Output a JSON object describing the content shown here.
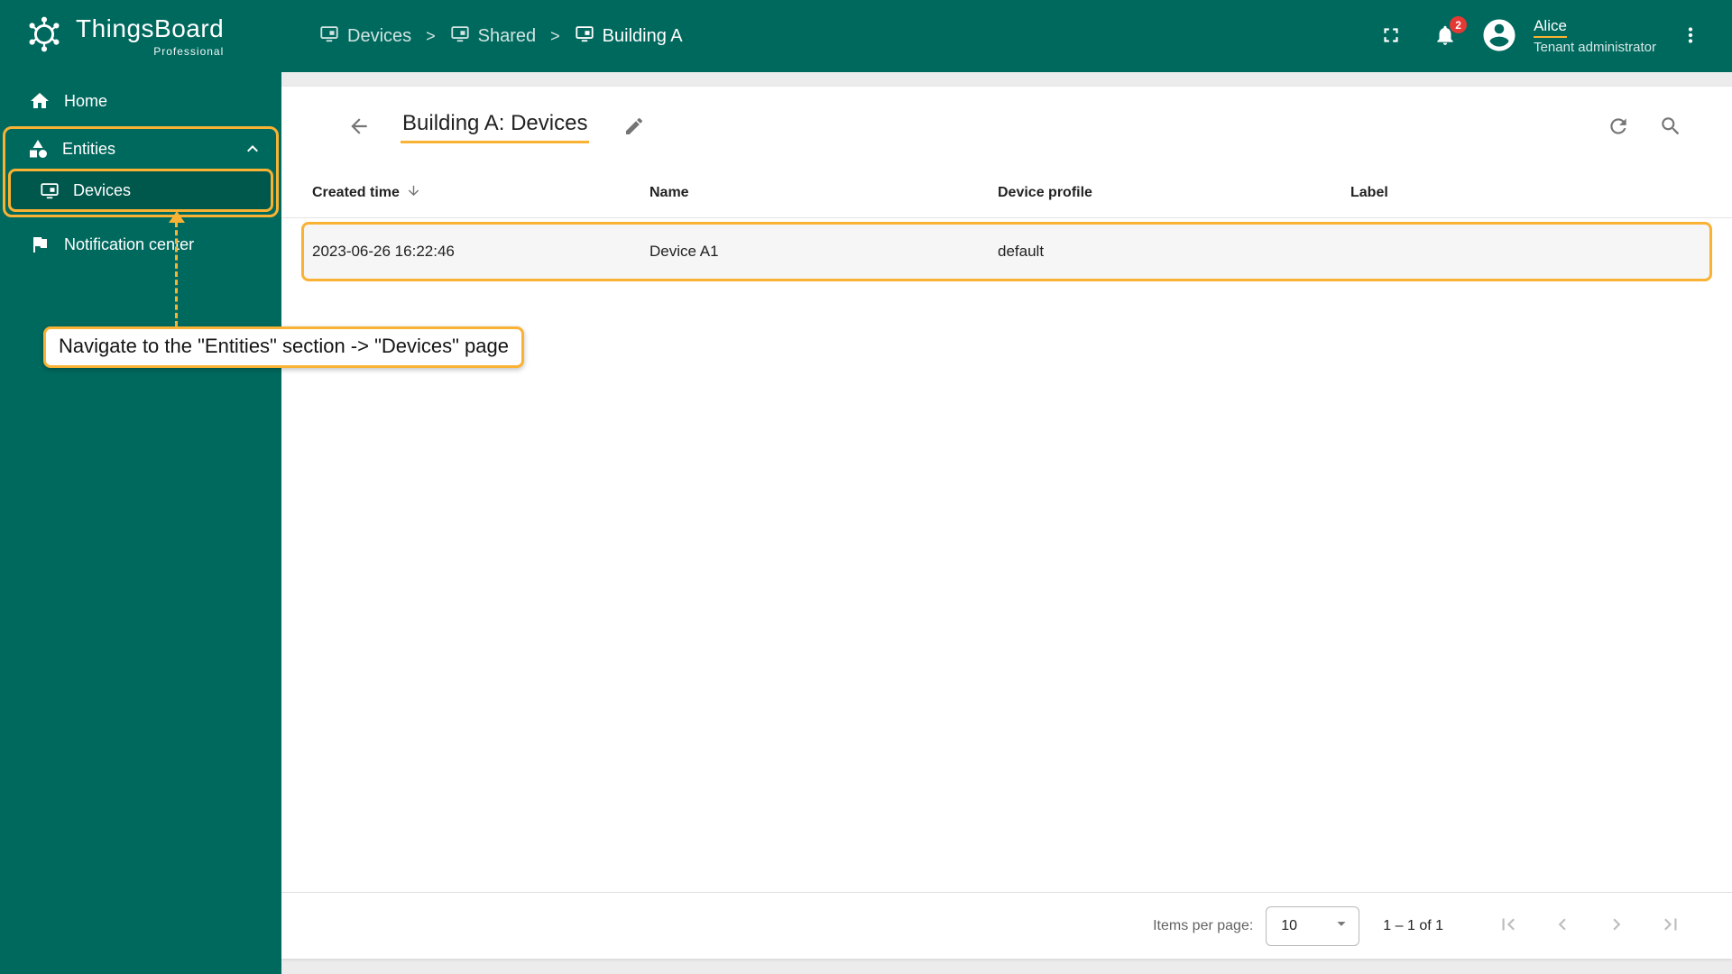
{
  "app": {
    "name": "ThingsBoard",
    "edition": "Professional"
  },
  "header": {
    "breadcrumb": {
      "separator": ">",
      "items": [
        {
          "label": "Devices"
        },
        {
          "label": "Shared"
        },
        {
          "label": "Building A"
        }
      ]
    },
    "notifications_count": "2",
    "user": {
      "name": "Alice",
      "role": "Tenant administrator"
    }
  },
  "sidebar": {
    "items": [
      {
        "label": "Home"
      },
      {
        "label": "Entities"
      },
      {
        "label": "Devices"
      },
      {
        "label": "Notification center"
      }
    ]
  },
  "main": {
    "title": "Building A: Devices",
    "table": {
      "columns": [
        {
          "label": "Created time"
        },
        {
          "label": "Name"
        },
        {
          "label": "Device profile"
        },
        {
          "label": "Label"
        }
      ],
      "rows": [
        {
          "created_time": "2023-06-26 16:22:46",
          "name": "Device A1",
          "device_profile": "default",
          "label": ""
        }
      ]
    },
    "pagination": {
      "items_per_page_label": "Items per page:",
      "items_per_page_value": "10",
      "range": "1 – 1 of 1"
    }
  },
  "annotation": {
    "text": "Navigate to the \"Entities\" section -> \"Devices\" page"
  },
  "colors": {
    "primary": "#00695e",
    "primary_dark": "#00574c",
    "accent": "#F9B233",
    "badge": "#E53935"
  }
}
